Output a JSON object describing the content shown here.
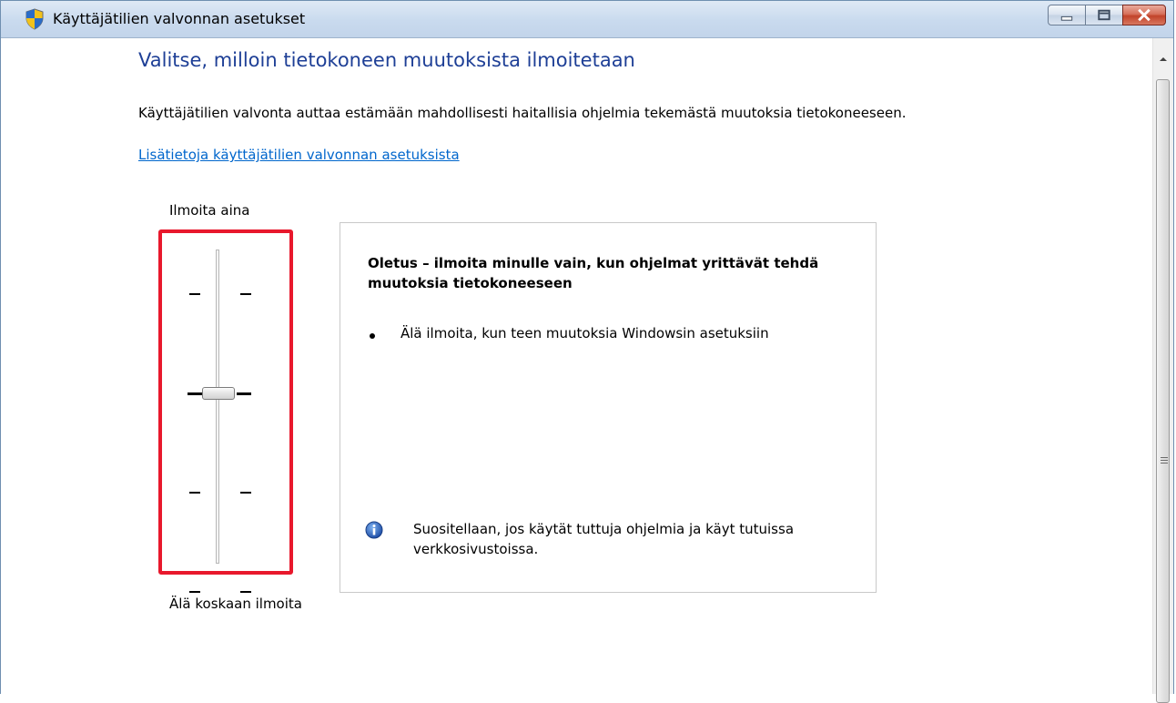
{
  "window": {
    "title": "Käyttäjätilien valvonnan asetukset",
    "icon": "uac-shield-icon",
    "buttons": [
      "minimize-icon",
      "maximize-icon",
      "close-icon"
    ]
  },
  "page": {
    "heading": "Valitse, milloin tietokoneen muutoksista ilmoitetaan",
    "description": "Käyttäjätilien valvonta auttaa estämään mahdollisesti haitallisia ohjelmia tekemästä muutoksia tietokoneeseen.",
    "link": "Lisätietoja käyttäjätilien valvonnan asetuksista"
  },
  "slider": {
    "top_label": "Ilmoita aina",
    "bottom_label": "Älä koskaan ilmoita",
    "levels": 4,
    "selected_level": 2,
    "highlight_color": "#e8182c"
  },
  "info": {
    "title": "Oletus – ilmoita minulle vain, kun ohjelmat yrittävät tehdä muutoksia tietokoneeseen",
    "bullet": "Älä ilmoita, kun teen muutoksia Windowsin asetuksiin",
    "recommendation": "Suositellaan, jos käytät tuttuja ohjelmia ja käyt tutuissa verkkosivustoissa.",
    "recommendation_icon": "info-icon"
  },
  "colors": {
    "heading": "#1e3f96",
    "link": "#0066cc"
  }
}
